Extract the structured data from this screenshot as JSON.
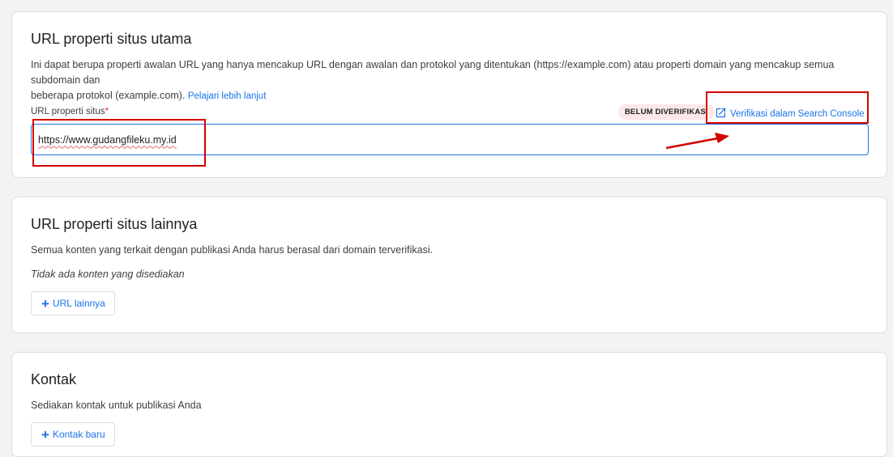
{
  "primary": {
    "title": "URL properti situs utama",
    "description_line1": "Ini dapat berupa properti awalan URL yang hanya mencakup URL dengan awalan dan protokol yang ditentukan (https://example.com) atau properti domain yang mencakup semua subdomain dan",
    "description_line2": "beberapa protokol (example.com).",
    "learn_more": "Pelajari lebih lanjut",
    "field_label": "URL properti situs",
    "required_mark": "*",
    "status_badge": "BELUM DIVERIFIKASI",
    "verify_link": "Verifikasi dalam Search Console",
    "url_value": "https://www.gudangfileku.my.id"
  },
  "other": {
    "title": "URL properti situs lainnya",
    "description": "Semua konten yang terkait dengan publikasi Anda harus berasal dari domain terverifikasi.",
    "empty_text": "Tidak ada konten yang disediakan",
    "add_button": "URL lainnya"
  },
  "contact": {
    "title": "Kontak",
    "description": "Sediakan kontak untuk publikasi Anda",
    "add_button": "Kontak baru"
  },
  "colors": {
    "accent": "#1a73e8",
    "badge_bg": "#fce8e6",
    "annotation": "#d40000"
  },
  "icons": {
    "verify": "open-in-new-icon",
    "add": "plus-icon"
  }
}
